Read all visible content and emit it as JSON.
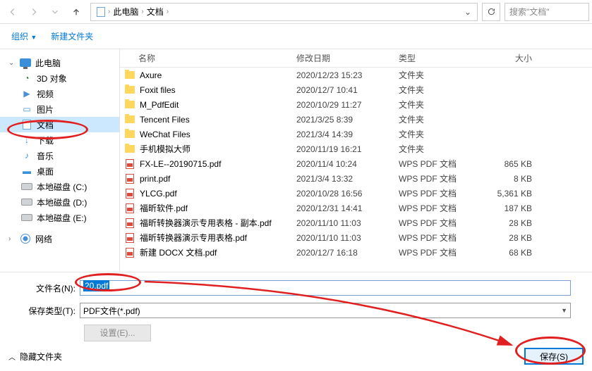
{
  "breadcrumb": {
    "root_icon": "folder",
    "segments": [
      "此电脑",
      "文档"
    ],
    "dropdown_icon": "chevron-down"
  },
  "search": {
    "placeholder": "搜索\"文档\""
  },
  "toolbar": {
    "organize": "组织",
    "new_folder": "新建文件夹"
  },
  "sidebar": {
    "items": [
      {
        "label": "此电脑",
        "icon": "monitor",
        "expanded": true,
        "level": 0
      },
      {
        "label": "3D 对象",
        "icon": "3d",
        "level": 1
      },
      {
        "label": "视频",
        "icon": "video",
        "level": 1
      },
      {
        "label": "图片",
        "icon": "picture",
        "level": 1
      },
      {
        "label": "文档",
        "icon": "document",
        "level": 1,
        "selected": true
      },
      {
        "label": "下载",
        "icon": "download",
        "level": 1
      },
      {
        "label": "音乐",
        "icon": "music",
        "level": 1
      },
      {
        "label": "桌面",
        "icon": "desktop",
        "level": 1
      },
      {
        "label": "本地磁盘 (C:)",
        "icon": "drive",
        "level": 1
      },
      {
        "label": "本地磁盘 (D:)",
        "icon": "drive",
        "level": 1
      },
      {
        "label": "本地磁盘 (E:)",
        "icon": "drive",
        "level": 1
      },
      {
        "label": "网络",
        "icon": "network",
        "level": 0
      }
    ]
  },
  "columns": {
    "name": "名称",
    "date": "修改日期",
    "type": "类型",
    "size": "大小"
  },
  "files": [
    {
      "name": "Axure",
      "date": "2020/12/23 15:23",
      "type": "文件夹",
      "size": "",
      "icon": "folder"
    },
    {
      "name": "Foxit files",
      "date": "2020/12/7 10:41",
      "type": "文件夹",
      "size": "",
      "icon": "folder"
    },
    {
      "name": "M_PdfEdit",
      "date": "2020/10/29 11:27",
      "type": "文件夹",
      "size": "",
      "icon": "folder"
    },
    {
      "name": "Tencent Files",
      "date": "2021/3/25 8:39",
      "type": "文件夹",
      "size": "",
      "icon": "folder"
    },
    {
      "name": "WeChat Files",
      "date": "2021/3/4 14:39",
      "type": "文件夹",
      "size": "",
      "icon": "folder"
    },
    {
      "name": "手机模拟大师",
      "date": "2020/11/19 16:21",
      "type": "文件夹",
      "size": "",
      "icon": "folder"
    },
    {
      "name": "FX-LE--20190715.pdf",
      "date": "2020/11/4 10:24",
      "type": "WPS PDF 文档",
      "size": "865 KB",
      "icon": "pdf"
    },
    {
      "name": "print.pdf",
      "date": "2021/3/4 13:32",
      "type": "WPS PDF 文档",
      "size": "8 KB",
      "icon": "pdf"
    },
    {
      "name": "YLCG.pdf",
      "date": "2020/10/28 16:56",
      "type": "WPS PDF 文档",
      "size": "5,361 KB",
      "icon": "pdf"
    },
    {
      "name": "福昕软件.pdf",
      "date": "2020/12/31 14:41",
      "type": "WPS PDF 文档",
      "size": "187 KB",
      "icon": "pdf"
    },
    {
      "name": "福昕转换器演示专用表格 - 副本.pdf",
      "date": "2020/11/10 11:03",
      "type": "WPS PDF 文档",
      "size": "28 KB",
      "icon": "pdf"
    },
    {
      "name": "福昕转换器演示专用表格.pdf",
      "date": "2020/11/10 11:03",
      "type": "WPS PDF 文档",
      "size": "28 KB",
      "icon": "pdf"
    },
    {
      "name": "新建 DOCX 文档.pdf",
      "date": "2020/12/7 16:18",
      "type": "WPS PDF 文档",
      "size": "68 KB",
      "icon": "pdf"
    }
  ],
  "form": {
    "filename_label": "文件名(N):",
    "filename_value": "20.pdf",
    "filetype_label": "保存类型(T):",
    "filetype_value": "PDF文件(*.pdf)",
    "settings_btn": "设置(E)..."
  },
  "footer": {
    "hide_folders": "隐藏文件夹",
    "save": "保存(S)"
  }
}
